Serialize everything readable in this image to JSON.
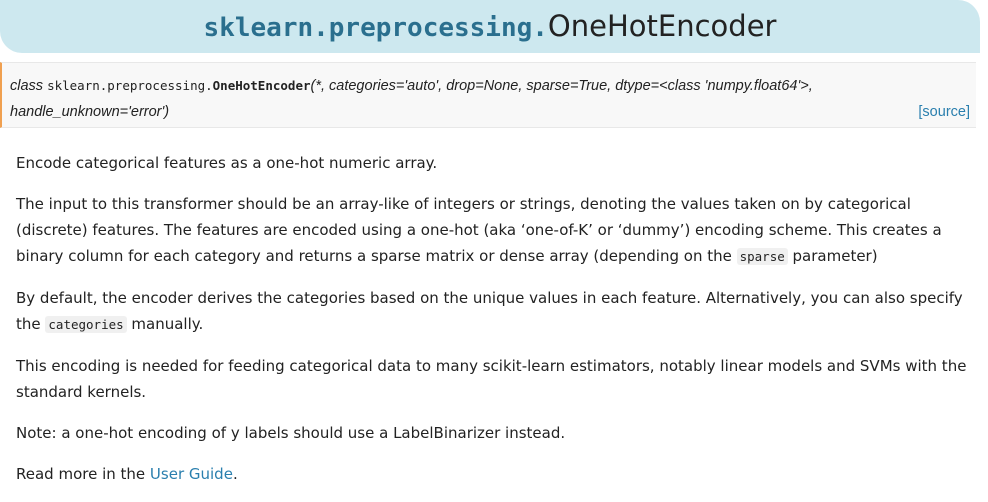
{
  "header": {
    "module": "sklearn.preprocessing.",
    "class_name": "OneHotEncoder"
  },
  "signature": {
    "keyword": "class",
    "module": "sklearn.preprocessing.",
    "name": "OneHotEncoder",
    "params_line1": "(*, categories='auto', drop=None, sparse=True, dtype=<class 'numpy.float64'>,",
    "params_line2": "handle_unknown='error')",
    "source_link": "[source]"
  },
  "body": {
    "p1": "Encode categorical features as a one-hot numeric array.",
    "p2_a": "The input to this transformer should be an array-like of integers or strings, denoting the values taken on by categorical (discrete) features. The features are encoded using a one-hot (aka ‘one-of-K’ or ‘dummy’) encoding scheme. This creates a binary column for each category and returns a sparse matrix or dense array (depending on the ",
    "p2_code": "sparse",
    "p2_b": " parameter)",
    "p3_a": "By default, the encoder derives the categories based on the unique values in each feature. Alternatively, you can also specify the ",
    "p3_code": "categories",
    "p3_b": " manually.",
    "p4": "This encoding is needed for feeding categorical data to many scikit-learn estimators, notably linear models and SVMs with the standard kernels.",
    "p5": "Note: a one-hot encoding of y labels should use a LabelBinarizer instead.",
    "p6_a": "Read more in the ",
    "p6_link": "User Guide",
    "p6_b": "."
  }
}
